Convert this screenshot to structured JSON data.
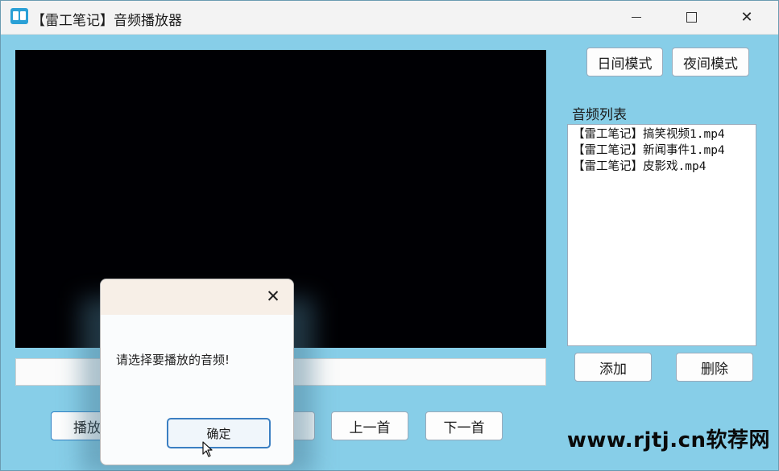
{
  "window": {
    "title": "【雷工笔记】音频播放器",
    "controls": {
      "minimize_icon": "minimize-icon",
      "maximize_icon": "maximize-icon",
      "close_icon": "close-icon"
    }
  },
  "mode_buttons": {
    "day": "日间模式",
    "night": "夜间模式"
  },
  "playlist": {
    "label": "音频列表",
    "tracks": [
      "【雷工笔记】搞笑视频1.mp4",
      "【雷工笔记】新闻事件1.mp4",
      "【雷工笔记】皮影戏.mp4"
    ],
    "add": "添加",
    "delete": "删除"
  },
  "controls": {
    "play": "播放",
    "prev": "上一首",
    "next": "下一首"
  },
  "dialog": {
    "message": "请选择要播放的音频!",
    "ok": "确定"
  },
  "watermark": "www.rjtj.cn软荐网"
}
